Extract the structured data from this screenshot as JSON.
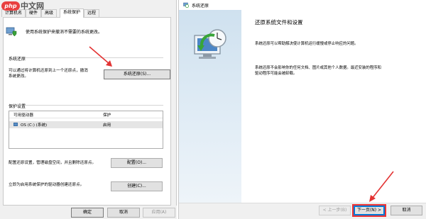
{
  "watermark": {
    "badge": "php",
    "text": "中文网"
  },
  "system_properties": {
    "tabs": [
      "计算机名",
      "硬件",
      "高级",
      "系统保护",
      "远程"
    ],
    "active_tab_index": 3,
    "intro": "使用系统保护来撤消不需要的系统更改。",
    "restore_section": {
      "title": "系统还原",
      "description_line1": "可以通过将计算机还原到上一个还原点，撤消",
      "description_line2": "系统更改。",
      "button": "系统还原(S)..."
    },
    "protection_section": {
      "title": "保护设置",
      "columns": [
        "可用驱动器",
        "保护"
      ],
      "rows": [
        {
          "drive": "OS (C:) (系统)",
          "status": "启用"
        }
      ],
      "configure_text": "配置还原设置，管理磁盘空间，并且删除还原点。",
      "configure_button": "配置(O)...",
      "create_text": "立即为启用系统保护的驱动器创建还原点。",
      "create_button": "创建(C)..."
    },
    "footer": {
      "ok": "确定",
      "cancel": "取消",
      "apply": "应用(A)"
    }
  },
  "system_restore": {
    "window_title": "系统还原",
    "heading": "还原系统文件和设置",
    "para1": "系统还原可以帮助解决使计算机运行缓慢或停止响应的问题。",
    "para2_line1": "系统还原不会影响你的任何文档、图片或其他个人数据。最近安装的程序和",
    "para2_line2": "驱动程序可能会被卸载。",
    "back_button": "< 上一步(B)",
    "next_button": "下一页(N) >",
    "cancel_button": "取消"
  },
  "colors": {
    "annotation": "#e33333",
    "accent": "#0078d7"
  }
}
